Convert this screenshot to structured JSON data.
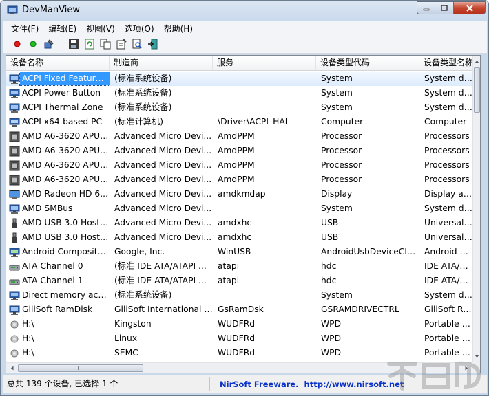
{
  "window": {
    "title": "DevManView"
  },
  "menu": [
    "文件(F)",
    "编辑(E)",
    "视图(V)",
    "选项(O)",
    "帮助(H)"
  ],
  "columns": [
    "设备名称",
    "制造商",
    "服务",
    "设备类型代码",
    "设备类型名称"
  ],
  "rows": [
    {
      "icon": "system-device-icon",
      "cells": [
        "ACPI Fixed Feature ...",
        "(标准系统设备)",
        "",
        "System",
        "System devi"
      ],
      "selected": true
    },
    {
      "icon": "system-device-icon",
      "cells": [
        "ACPI Power Button",
        "(标准系统设备)",
        "",
        "System",
        "System devi"
      ]
    },
    {
      "icon": "system-device-icon",
      "cells": [
        "ACPI Thermal Zone",
        "(标准系统设备)",
        "",
        "System",
        "System devi"
      ]
    },
    {
      "icon": "computer-icon",
      "cells": [
        "ACPI x64-based PC",
        "(标准计算机)",
        "\\Driver\\ACPI_HAL",
        "Computer",
        "Computer"
      ]
    },
    {
      "icon": "processor-icon",
      "cells": [
        "AMD A6-3620 APU ...",
        "Advanced Micro Devi...",
        "AmdPPM",
        "Processor",
        "Processors"
      ]
    },
    {
      "icon": "processor-icon",
      "cells": [
        "AMD A6-3620 APU ...",
        "Advanced Micro Devi...",
        "AmdPPM",
        "Processor",
        "Processors"
      ]
    },
    {
      "icon": "processor-icon",
      "cells": [
        "AMD A6-3620 APU ...",
        "Advanced Micro Devi...",
        "AmdPPM",
        "Processor",
        "Processors"
      ]
    },
    {
      "icon": "processor-icon",
      "cells": [
        "AMD A6-3620 APU ...",
        "Advanced Micro Devi...",
        "AmdPPM",
        "Processor",
        "Processors"
      ]
    },
    {
      "icon": "display-icon",
      "cells": [
        "AMD Radeon HD 6...",
        "Advanced Micro Devi...",
        "amdkmdap",
        "Display",
        "Display ada"
      ]
    },
    {
      "icon": "system-device-icon",
      "cells": [
        "AMD SMBus",
        "Advanced Micro Devi...",
        "",
        "System",
        "System devi"
      ]
    },
    {
      "icon": "usb-icon",
      "cells": [
        "AMD USB 3.0 Host ...",
        "Advanced Micro Devi...",
        "amdxhc",
        "USB",
        "Universal Se"
      ]
    },
    {
      "icon": "usb-icon",
      "cells": [
        "AMD USB 3.0 Host ...",
        "Advanced Micro Devi...",
        "amdxhc",
        "USB",
        "Universal Se"
      ]
    },
    {
      "icon": "android-device-icon",
      "cells": [
        "Android Composite...",
        "Google, Inc.",
        "WinUSB",
        "AndroidUsbDeviceClass",
        "Android Pho"
      ]
    },
    {
      "icon": "ide-channel-icon",
      "cells": [
        "ATA Channel 0",
        "(标准 IDE ATA/ATAPI ...",
        "atapi",
        "hdc",
        "IDE ATA/ATA"
      ]
    },
    {
      "icon": "ide-channel-icon",
      "cells": [
        "ATA Channel 1",
        "(标准 IDE ATA/ATAPI ...",
        "atapi",
        "hdc",
        "IDE ATA/ATA"
      ]
    },
    {
      "icon": "system-device-icon",
      "cells": [
        "Direct memory acce...",
        "(标准系统设备)",
        "",
        "System",
        "System devi"
      ]
    },
    {
      "icon": "ramdisk-icon",
      "cells": [
        "GiliSoft RamDisk",
        "GiliSoft International L...",
        "GsRamDsk",
        "GSRAMDRIVECTRL",
        "GiliSoft Ram"
      ]
    },
    {
      "icon": "portable-device-icon",
      "cells": [
        "H:\\",
        "Kingston",
        "WUDFRd",
        "WPD",
        "Portable De"
      ]
    },
    {
      "icon": "portable-device-icon",
      "cells": [
        "H:\\",
        "Linux",
        "WUDFRd",
        "WPD",
        "Portable De"
      ]
    },
    {
      "icon": "portable-device-icon",
      "cells": [
        "H:\\",
        "SEMC",
        "WUDFRd",
        "WPD",
        "Portable De"
      ]
    }
  ],
  "status": {
    "summary": "总共 139 个设备, 已选择 1 个",
    "credit": "NirSoft Freeware.",
    "url": "http://www.nirsoft.net"
  },
  "colors": {
    "selection": "#3399ff",
    "link": "#0b32c8"
  }
}
